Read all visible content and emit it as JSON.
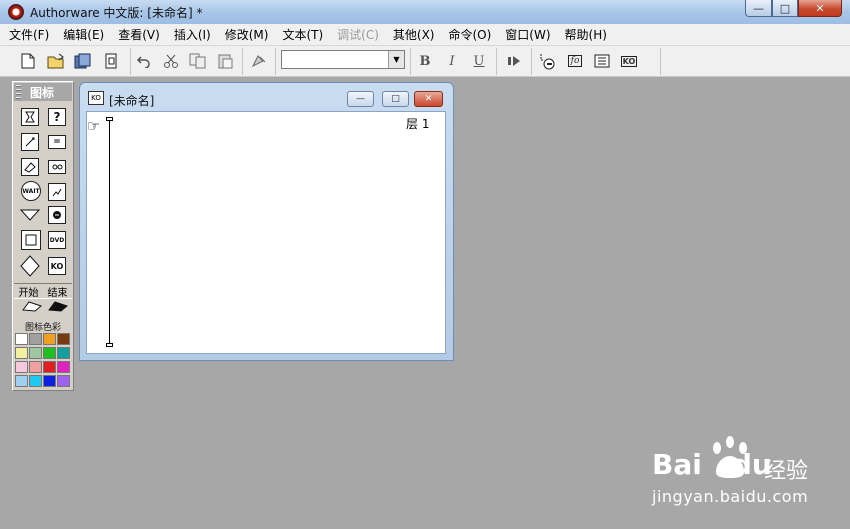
{
  "window": {
    "title": "Authorware 中文版: [未命名] *",
    "min_glyph": "—",
    "max_glyph": "□",
    "close_glyph": "✕"
  },
  "menubar": {
    "items": [
      {
        "label": "文件(F)",
        "enabled": true
      },
      {
        "label": "编辑(E)",
        "enabled": true
      },
      {
        "label": "查看(V)",
        "enabled": true
      },
      {
        "label": "插入(I)",
        "enabled": true
      },
      {
        "label": "修改(M)",
        "enabled": true
      },
      {
        "label": "文本(T)",
        "enabled": true
      },
      {
        "label": "调试(C)",
        "enabled": false
      },
      {
        "label": "其他(X)",
        "enabled": true
      },
      {
        "label": "命令(O)",
        "enabled": true
      },
      {
        "label": "窗口(W)",
        "enabled": true
      },
      {
        "label": "帮助(H)",
        "enabled": true
      }
    ]
  },
  "toolbar": {
    "font_select_value": "",
    "bold_label": "B",
    "italic_label": "I",
    "underline_label": "U",
    "fo_label": "fo",
    "ko_label": "KO"
  },
  "icon_palette": {
    "title": "图标",
    "icons": [
      "display-icon",
      "interaction-icon",
      "calculation-icon",
      "map-icon",
      "motion-icon",
      "digital-movie-icon",
      "erase-icon",
      "sound-icon",
      "wait-icon",
      "video-icon",
      "navigate-icon",
      "animation-icon",
      "framework-icon",
      "dvd-icon",
      "decision-icon",
      "knowledge-object-icon"
    ],
    "wait_label": "WAIT",
    "dvd_label": "DVD",
    "ko_label": "KO",
    "start_label": "开始",
    "end_label": "结束",
    "color_label": "图标色彩",
    "colors": [
      "#ffffff",
      "#a0a0a0",
      "#f0a020",
      "#7a3a10",
      "#f5f0a0",
      "#a0c8a0",
      "#20c020",
      "#10a0a0",
      "#f5c8e0",
      "#f0a0a0",
      "#e02020",
      "#e020c0",
      "#a0d0f0",
      "#20c8f0",
      "#1020e0",
      "#a060f0"
    ]
  },
  "design_window": {
    "title": "[未命名]",
    "layer_label": "层 1"
  },
  "watermark": {
    "brand": "Bai",
    "brand_suffix": "du",
    "cn": "经验",
    "url": "jingyan.baidu.com"
  }
}
